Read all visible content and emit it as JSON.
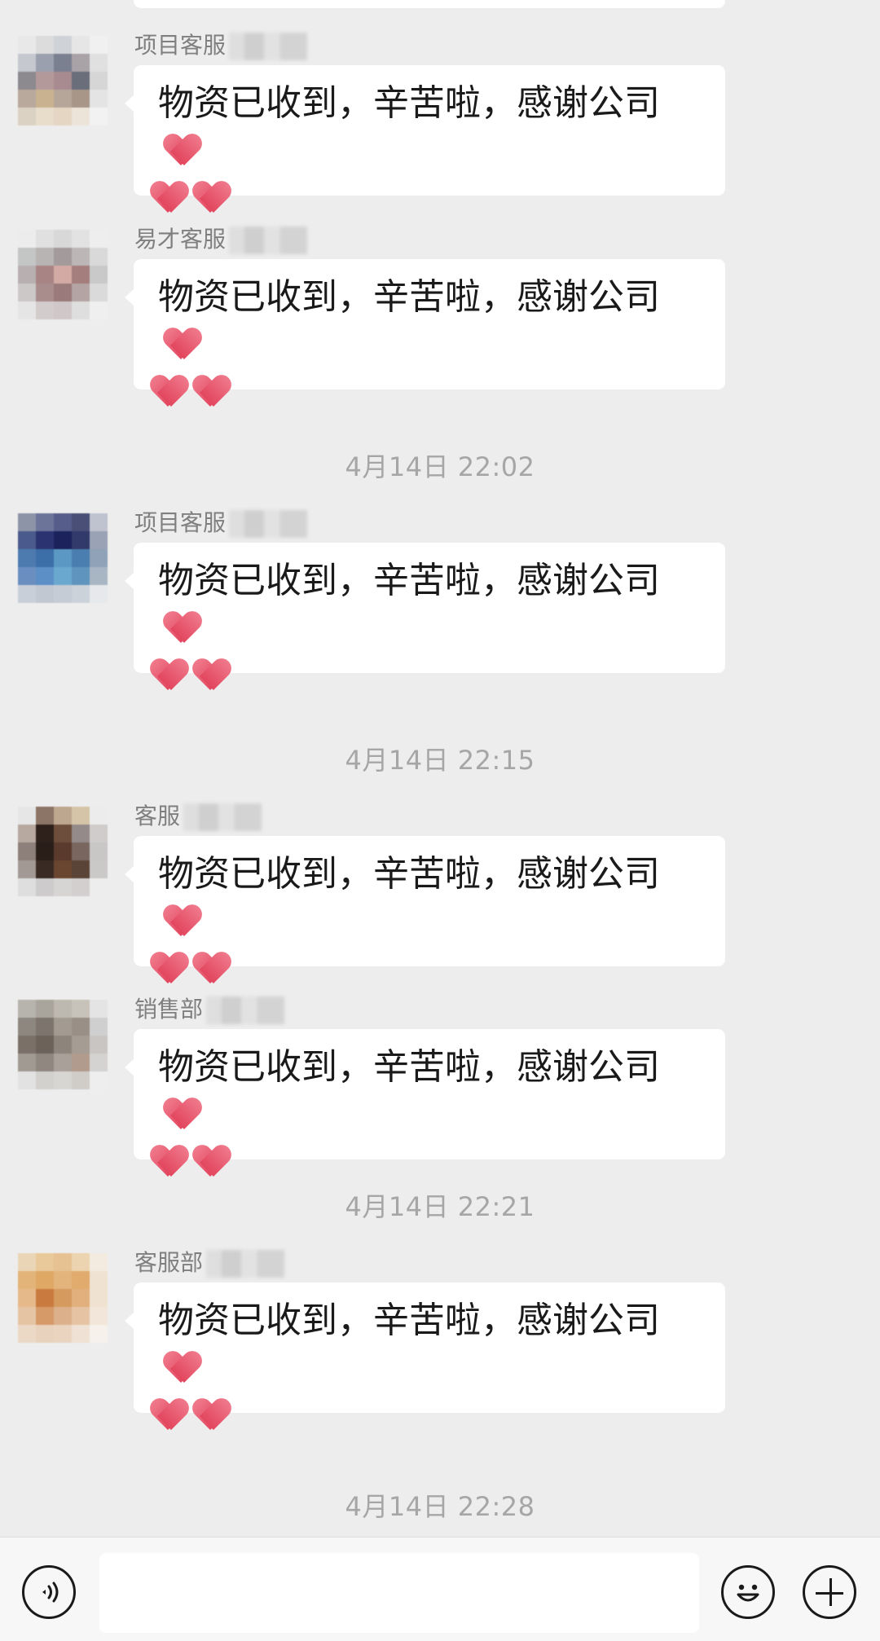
{
  "chat": {
    "items": [
      {
        "type": "message",
        "sender": "项目客服",
        "text": "物资已收到，辛苦啦，感谢公司",
        "avatar_colors": [
          "#e8e8e8",
          "#dcdcdc",
          "#cfd3d8",
          "#e6e6e6",
          "#f0f0f0",
          "#c5c8cf",
          "#9aa0ad",
          "#7b8091",
          "#a9a2a6",
          "#e0e0e0",
          "#8c8a8e",
          "#b4999a",
          "#a78b90",
          "#6a6d7a",
          "#d6d6d6",
          "#b9a89c",
          "#c8b28f",
          "#b6a69a",
          "#a89689",
          "#e4e4e4",
          "#dcd2c3",
          "#e8dccb",
          "#e5d6c3",
          "#ece4d9",
          "#f2f2f2"
        ]
      },
      {
        "type": "message",
        "sender": "易才客服",
        "text": "物资已收到，辛苦啦，感谢公司",
        "avatar_colors": [
          "#ececec",
          "#e0e0e0",
          "#d8d8d8",
          "#e2e2e2",
          "#eeeeee",
          "#c4c6c6",
          "#b9b4b4",
          "#a39b9b",
          "#bcb6b6",
          "#d9d9d9",
          "#b8b0b0",
          "#a88484",
          "#d4aaa4",
          "#a47e7c",
          "#c9c9c9",
          "#cdc8c8",
          "#a98c8c",
          "#9a7a7a",
          "#b4a4a4",
          "#dadada",
          "#e5e5e5",
          "#d2cccc",
          "#d0c8c8",
          "#dedede",
          "#efefef"
        ]
      },
      {
        "type": "timestamp",
        "text": "4月14日 22:02"
      },
      {
        "type": "message",
        "sender": "项目客服",
        "text": "物资已收到，辛苦啦，感谢公司",
        "avatar_colors": [
          "#8d94a8",
          "#6c749a",
          "#575d8a",
          "#4a4f78",
          "#bfc3cf",
          "#4b5a8c",
          "#2b3471",
          "#1c225c",
          "#313a6a",
          "#9aa2b5",
          "#4d7bb0",
          "#3c6ea8",
          "#5b98c4",
          "#4a7eb0",
          "#8fa2b7",
          "#6b8ec0",
          "#5b8fc6",
          "#6aa8cf",
          "#5f94be",
          "#a8b6c4",
          "#c9cfd8",
          "#c1c8d2",
          "#c6ccd6",
          "#ccd2da",
          "#e6e8eb"
        ]
      },
      {
        "type": "timestamp",
        "text": "4月14日 22:15"
      },
      {
        "type": "message",
        "sender": "客服",
        "text": "物资已收到，辛苦啦，感谢公司",
        "avatar_colors": [
          "#e6e6e6",
          "#8c7466",
          "#bda88f",
          "#d6c4a8",
          "#ececec",
          "#b7a8a0",
          "#2e211c",
          "#6d4d3b",
          "#958a8a",
          "#d0cccc",
          "#8d7f79",
          "#2a1e19",
          "#5a3a2c",
          "#79675f",
          "#c9c6c6",
          "#a39994",
          "#3a2a24",
          "#6a4631",
          "#5a4438",
          "#cbc8c8",
          "#dedede",
          "#cdcbcb",
          "#d7d4d4",
          "#d3cfcf",
          "#ededed"
        ]
      },
      {
        "type": "message",
        "sender": "销售部",
        "text": "物资已收到，辛苦啦，感谢公司",
        "avatar_colors": [
          "#b7b3ad",
          "#a9a49c",
          "#bdb8b0",
          "#c7c2ba",
          "#e4e4e4",
          "#8e8780",
          "#7d756d",
          "#a39b92",
          "#998f86",
          "#cfcfcf",
          "#7a7067",
          "#6d6259",
          "#8d847b",
          "#a59c94",
          "#c8c5c2",
          "#a19a92",
          "#8f8780",
          "#a8a099",
          "#b19b8c",
          "#d5d3d1",
          "#e2e2e2",
          "#d3d1ce",
          "#d8d6d3",
          "#d0cdc9",
          "#eeeeee"
        ]
      },
      {
        "type": "timestamp",
        "text": "4月14日 22:21"
      },
      {
        "type": "message",
        "sender": "客服部",
        "text": "物资已收到，辛苦啦，感谢公司",
        "avatar_colors": [
          "#ead6b6",
          "#e9c89a",
          "#e6c293",
          "#ecd4b0",
          "#f3ebe0",
          "#e3b47a",
          "#dfa865",
          "#e3b47b",
          "#e0ab6c",
          "#efe2d1",
          "#e6b98a",
          "#c97a3e",
          "#d49a5e",
          "#e1b07c",
          "#f0e2d0",
          "#e5c4a4",
          "#d69a69",
          "#dcb08a",
          "#e5c3a3",
          "#f1e6d9",
          "#ebd9c6",
          "#e9d2bd",
          "#ead4c0",
          "#efe2d4",
          "#f6f1eb"
        ]
      },
      {
        "type": "timestamp",
        "text": "4月14日 22:28"
      }
    ]
  },
  "input_bar": {
    "voice_icon": "voice-wave-icon",
    "emoji_icon": "smiley-face-icon",
    "plus_icon": "plus-circle-icon",
    "input_value": ""
  },
  "colors": {
    "background": "#ededed",
    "bubble": "#ffffff",
    "heart": "#e2465e",
    "timestamp": "#a6a6a6",
    "sender": "#7f7f7f"
  }
}
